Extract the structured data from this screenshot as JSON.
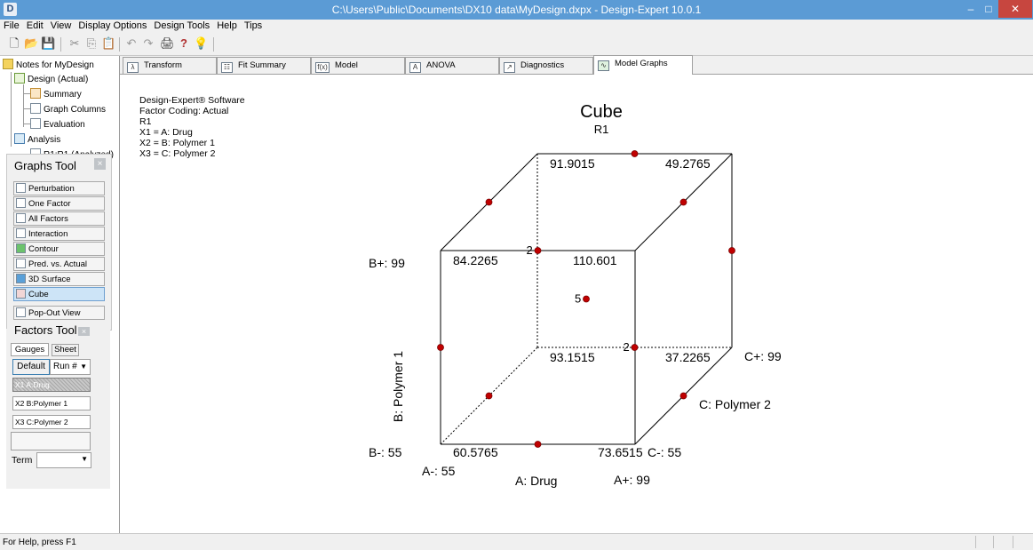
{
  "window": {
    "title": "C:\\Users\\Public\\Documents\\DX10 data\\MyDesign.dxpx - Design-Expert 10.0.1",
    "app_icon": "D",
    "minimize": "–",
    "maximize": "□",
    "close": "✕"
  },
  "menu": [
    "File",
    "Edit",
    "View",
    "Display Options",
    "Design Tools",
    "Help",
    "Tips"
  ],
  "toolbar": {
    "new": "🗋",
    "open": "📂",
    "save": "💾",
    "cut": "✂",
    "copy": "⎘",
    "paste": "📋",
    "undo": "↶",
    "redo": "↷",
    "print": "🖨",
    "help": "?",
    "tip": "💡"
  },
  "tree": {
    "root": "Notes for MyDesign",
    "design": "Design (Actual)",
    "summary": "Summary",
    "graph_columns": "Graph Columns",
    "evaluation": "Evaluation",
    "analysis": "Analysis",
    "r1": "R1:R1 (Analyzed)"
  },
  "graphs_tool": {
    "title": "Graphs Tool",
    "close": "×",
    "buttons": [
      "Perturbation",
      "One Factor",
      "All Factors",
      "Interaction",
      "Contour",
      "Pred. vs. Actual",
      "3D Surface",
      "Cube"
    ],
    "popout": "Pop-Out View"
  },
  "factors_tool": {
    "title": "Factors Tool",
    "close": "×",
    "tabs": [
      "Gauges",
      "Sheet"
    ],
    "default_button": "Default",
    "run_select": "Run #",
    "factors": [
      {
        "code": "X1",
        "name": "A:Drug"
      },
      {
        "code": "X2",
        "name": "B:Polymer 1"
      },
      {
        "code": "X3",
        "name": "C:Polymer 2"
      }
    ],
    "term_label": "Term"
  },
  "tabs": [
    "Transform",
    "Fit Summary",
    "Model",
    "ANOVA",
    "Diagnostics",
    "Model Graphs"
  ],
  "tab_icons": [
    "λ",
    "☷",
    "f(x)",
    "A",
    "↗",
    "∿"
  ],
  "notes": [
    "Design-Expert® Software",
    "Factor Coding: Actual",
    "R1",
    "X1 = A: Drug",
    "X2 = B: Polymer 1",
    "X3 = C: Polymer 2"
  ],
  "chart_data": {
    "type": "cube",
    "title": "Cube",
    "subtitle": "R1",
    "axes": {
      "A": {
        "label": "A: Drug",
        "low": "A-: 55",
        "high": "A+: 99"
      },
      "B": {
        "label": "B: Polymer 1",
        "low": "B-: 55",
        "high": "B+: 99"
      },
      "C": {
        "label": "C: Polymer 2",
        "low": "C-: 55",
        "high": "C+: 99"
      }
    },
    "corners": [
      {
        "A": "-",
        "B": "-",
        "C": "-",
        "value": "60.5765"
      },
      {
        "A": "+",
        "B": "-",
        "C": "-",
        "value": "73.6515"
      },
      {
        "A": "-",
        "B": "+",
        "C": "-",
        "value": "84.2265"
      },
      {
        "A": "+",
        "B": "+",
        "C": "-",
        "value": "110.601"
      },
      {
        "A": "-",
        "B": "-",
        "C": "+",
        "value": "93.1515"
      },
      {
        "A": "+",
        "B": "-",
        "C": "+",
        "value": "37.2265"
      },
      {
        "A": "-",
        "B": "+",
        "C": "+",
        "value": "91.9015"
      },
      {
        "A": "+",
        "B": "+",
        "C": "+",
        "value": "49.2765"
      }
    ],
    "design_points": [
      {
        "A": 0,
        "B": -1,
        "C": -1
      },
      {
        "A": -1,
        "B": 0,
        "C": -1
      },
      {
        "A": 0,
        "B": 1,
        "C": 1
      },
      {
        "A": 1,
        "B": 0,
        "C": 1
      },
      {
        "A": -1,
        "B": 1,
        "C": 0
      },
      {
        "A": 1,
        "B": 1,
        "C": 0
      },
      {
        "A": -1,
        "B": -1,
        "C": 0
      },
      {
        "A": 1,
        "B": -1,
        "C": 0
      },
      {
        "A": 0,
        "B": 1,
        "C": -1,
        "count": "2"
      },
      {
        "A": 0,
        "B": -1,
        "C": 1,
        "count": "2"
      },
      {
        "A": 0,
        "B": 0,
        "C": 0,
        "count": "5"
      }
    ]
  },
  "status": "For Help, press F1"
}
